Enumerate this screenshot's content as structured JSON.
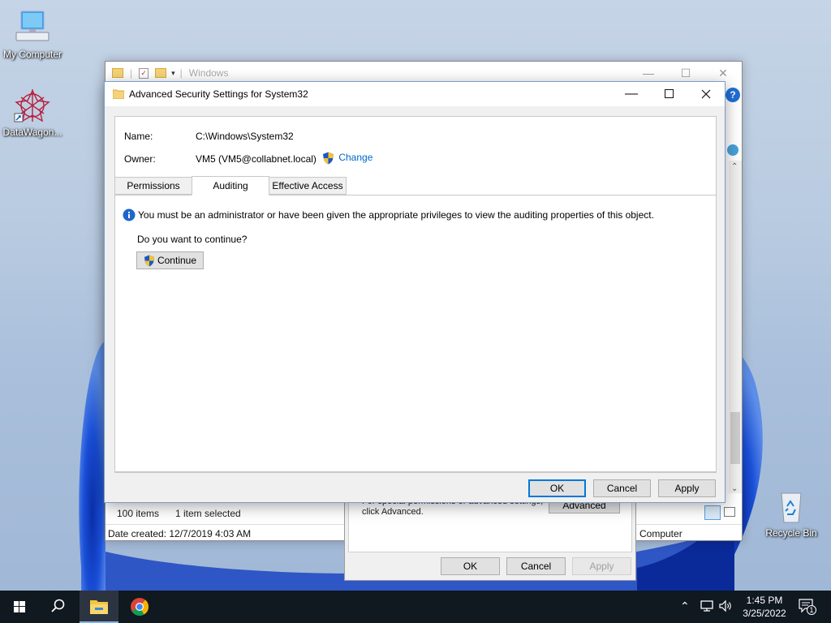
{
  "desktop": {
    "icons": [
      {
        "label": "My Computer"
      },
      {
        "label": "DataWagon..."
      },
      {
        "label": "Recycle Bin"
      }
    ]
  },
  "explorer": {
    "title": "Windows",
    "status_items": "100 items",
    "status_selected": "1 item selected",
    "date_created": "Date created: 12/7/2019 4:03 AM",
    "location": "Computer"
  },
  "properties_dialog": {
    "note": "For special permissions or advanced settings, click Advanced.",
    "advanced_label": "Advanced",
    "ok_label": "OK",
    "cancel_label": "Cancel",
    "apply_label": "Apply"
  },
  "dialog": {
    "title": "Advanced Security Settings for System32",
    "name_label": "Name:",
    "name_value": "C:\\Windows\\System32",
    "owner_label": "Owner:",
    "owner_value": "VM5 (VM5@collabnet.local)",
    "change_label": "Change",
    "tabs": [
      {
        "label": "Permissions"
      },
      {
        "label": "Auditing"
      },
      {
        "label": "Effective Access"
      }
    ],
    "active_tab": "Auditing",
    "info_message": "You must be an administrator or have been given the appropriate privileges to view the auditing properties of this object.",
    "question": "Do you want to continue?",
    "continue_label": "Continue",
    "ok_label": "OK",
    "cancel_label": "Cancel",
    "apply_label": "Apply"
  },
  "taskbar": {
    "time": "1:45 PM",
    "date": "3/25/2022",
    "notification_count": "1"
  },
  "colors": {
    "accent": "#0078d7",
    "link": "#0066cc",
    "taskbar": "#101820"
  }
}
